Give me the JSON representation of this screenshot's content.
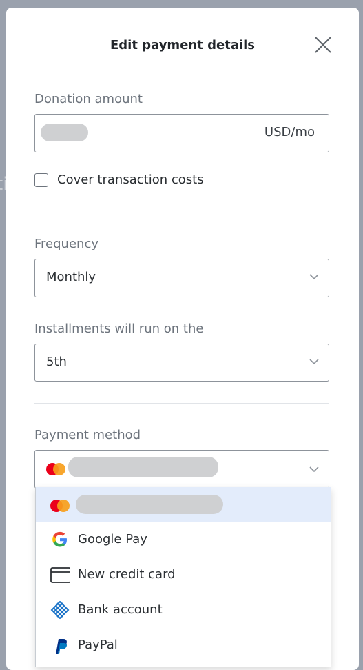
{
  "modal": {
    "title": "Edit payment details"
  },
  "donation": {
    "label": "Donation amount",
    "suffix": "USD/mo",
    "cover_costs_label": "Cover transaction costs",
    "cover_costs_checked": false
  },
  "frequency": {
    "label": "Frequency",
    "value": "Monthly"
  },
  "installments": {
    "label": "Installments will run on the",
    "value": "5th"
  },
  "payment": {
    "label": "Payment method",
    "options": [
      {
        "label": "",
        "icon": "mastercard-icon",
        "selected": true
      },
      {
        "label": "Google Pay",
        "icon": "google-icon",
        "selected": false
      },
      {
        "label": "New credit card",
        "icon": "credit-card-icon",
        "selected": false
      },
      {
        "label": "Bank account",
        "icon": "bank-icon",
        "selected": false
      },
      {
        "label": "PayPal",
        "icon": "paypal-icon",
        "selected": false
      }
    ]
  }
}
